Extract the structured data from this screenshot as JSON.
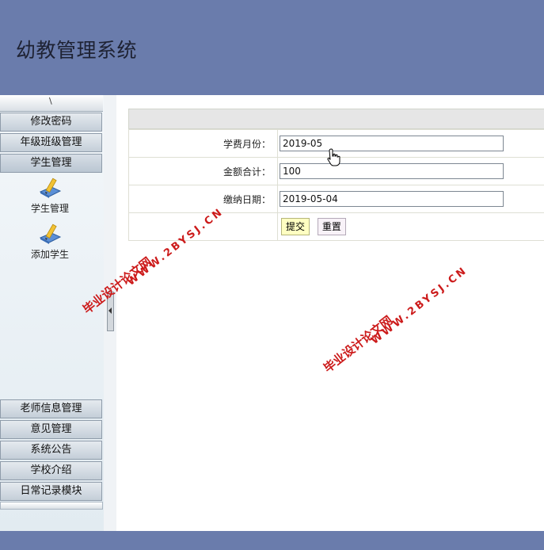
{
  "app": {
    "title": "幼教管理系统"
  },
  "sidebar": {
    "collapse_mark": "\\",
    "menus_top": [
      {
        "label": "修改密码"
      },
      {
        "label": "年级班级管理"
      },
      {
        "label": "学生管理"
      }
    ],
    "sub_items": [
      {
        "label": "学生管理",
        "icon": "pencil-book-icon"
      },
      {
        "label": "添加学生",
        "icon": "pencil-book-icon"
      }
    ],
    "menus_bottom": [
      {
        "label": "老师信息管理"
      },
      {
        "label": "意见管理"
      },
      {
        "label": "系统公告"
      },
      {
        "label": "学校介绍"
      },
      {
        "label": "日常记录模块"
      }
    ]
  },
  "form": {
    "fields": [
      {
        "label": "学费月份：",
        "value": "2019-05"
      },
      {
        "label": "金额合计：",
        "value": "100"
      },
      {
        "label": "缴纳日期：",
        "value": "2019-05-04"
      }
    ],
    "submit_label": "提交",
    "reset_label": "重置"
  },
  "watermarks": {
    "line1": "毕业设计论文网",
    "line2": "WWW.2BYSJ.CN"
  },
  "colors": {
    "header_bg": "#6a7cac",
    "watermark": "#cc1a1a",
    "submit_bg": "#ffffc2"
  }
}
